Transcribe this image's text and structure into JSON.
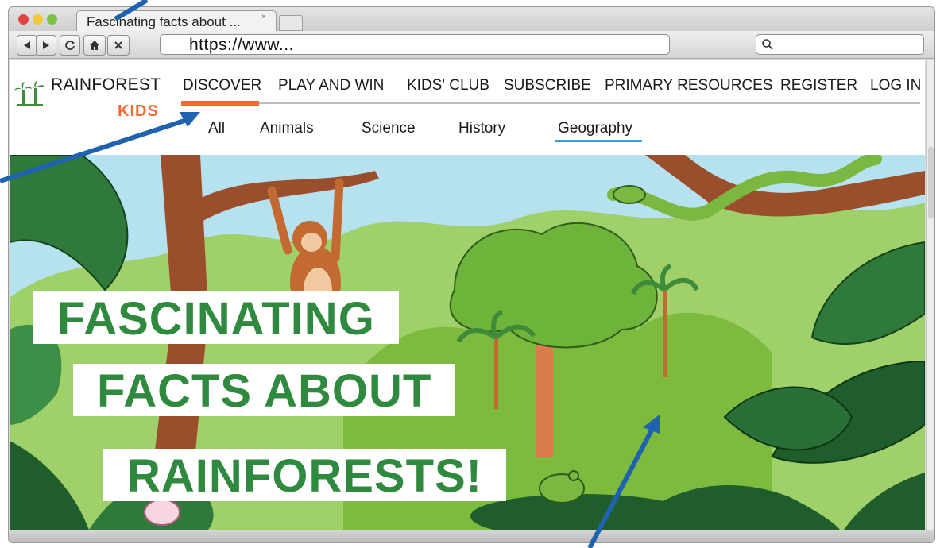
{
  "browser": {
    "tab_title": "Fascinating facts about ...",
    "tab_close": "×",
    "url": "https://www...",
    "colors": {
      "chrome": "#d9d9d9",
      "red": "#e0443e",
      "yellow": "#f2c73a",
      "green": "#7cc143"
    }
  },
  "site": {
    "brand": "RAINFOREST",
    "brand_kids": "KIDS",
    "main_nav": [
      "DISCOVER",
      "PLAY AND WIN",
      "KIDS' CLUB",
      "SUBSCRIBE",
      "PRIMARY RESOURCES",
      "REGISTER",
      "LOG IN"
    ],
    "active_main": "DISCOVER",
    "sub_nav": [
      "All",
      "Animals",
      "Science",
      "History",
      "Geography"
    ],
    "active_sub": "Geography",
    "colors": {
      "accent_orange": "#f26a2e",
      "accent_blue": "#3aa2d6",
      "headline_green": "#2f8a3f"
    }
  },
  "hero": {
    "headline_lines": [
      "FASCINATING",
      "FACTS ABOUT",
      "RAINFORESTS!"
    ]
  },
  "icons": [
    "back-icon",
    "forward-icon",
    "reload-icon",
    "home-icon",
    "stop-icon",
    "search-icon",
    "palm-tree-logo-icon"
  ]
}
